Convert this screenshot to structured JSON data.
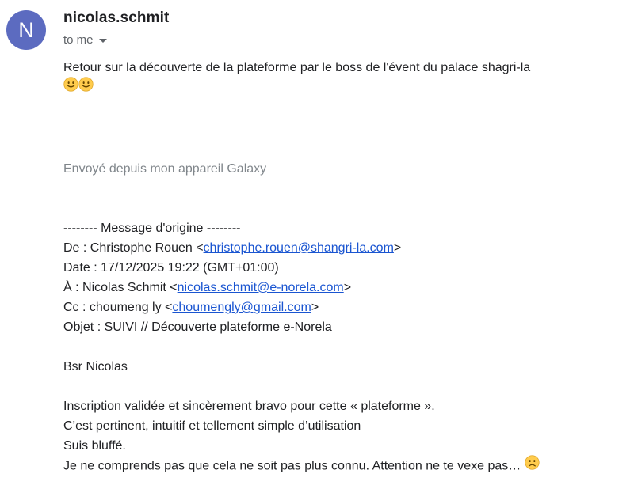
{
  "sender": {
    "avatar_letter": "N",
    "name": "nicolas.schmit",
    "recipient_label": "to me"
  },
  "message": {
    "line1": "Retour sur la découverte de la plateforme par le boss de l'évent du palace shagri-la",
    "signature": "Envoyé depuis mon appareil Galaxy"
  },
  "forwarded": {
    "header": "-------- Message d'origine --------",
    "from_prefix": "De : Christophe Rouen <",
    "from_email": "christophe.rouen@shangri-la.com",
    "from_suffix": ">",
    "date": "Date : 17/12/2025 19:22 (GMT+01:00)",
    "to_prefix": "À : Nicolas Schmit <",
    "to_email": "nicolas.schmit@e-norela.com",
    "to_suffix": ">",
    "cc_prefix": "Cc : choumeng ly <",
    "cc_email": "choumengly@gmail.com",
    "cc_suffix": ">",
    "subject": "Objet : SUIVI // Découverte plateforme e-Norela",
    "greeting": "Bsr Nicolas",
    "para1": "Inscription validée et sincèrement bravo pour cette « plateforme ».",
    "para2": "C’est pertinent, intuitif et tellement simple d’utilisation",
    "para3": "Suis bluffé.",
    "para4": "Je ne comprends pas que cela ne soit pas plus connu. Attention ne te vexe pas… "
  },
  "icons": {
    "smile": "slightly-smiling-face-icon",
    "frown": "slightly-frowning-face-icon",
    "caret": "chevron-down-icon"
  },
  "colors": {
    "avatar_bg": "#5c6bc0",
    "link": "#1a55d1",
    "muted": "#5f6368",
    "signature": "#80868b",
    "emoji_face": "#ffcc4d"
  }
}
